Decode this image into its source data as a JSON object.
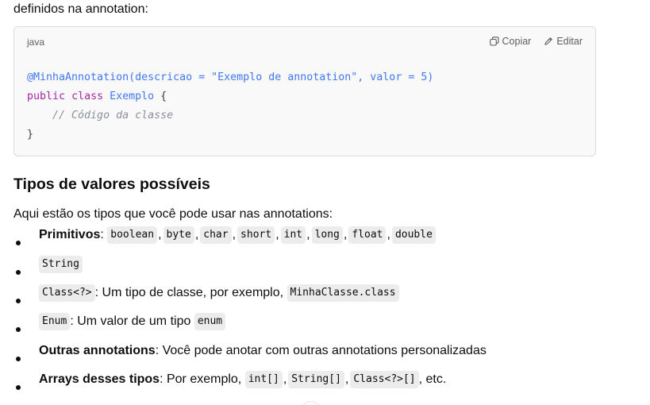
{
  "intro_text": "definidos na annotation:",
  "code_block": {
    "language": "java",
    "copy_label": "Copiar",
    "edit_label": "Editar",
    "lines": {
      "annotation": "@MinhaAnnotation(descricao = \"Exemplo de annotation\", valor = 5)",
      "kw_public": "public",
      "kw_class": "class",
      "class_name": "Exemplo",
      "brace_open": "{",
      "comment": "    // Código da classe",
      "brace_close": "}"
    }
  },
  "section": {
    "heading": "Tipos de valores possíveis",
    "intro": "Aqui estão os tipos que você pode usar nas annotations:"
  },
  "bullets": {
    "primitives": {
      "label": "Primitivos",
      "colon": ":",
      "types": [
        "boolean",
        "byte",
        "char",
        "short",
        "int",
        "long",
        "float",
        "double"
      ]
    },
    "string": {
      "code": "String"
    },
    "class": {
      "code": "Class<?>",
      "text": ": Um tipo de classe, por exemplo,",
      "example": "MinhaClasse.class"
    },
    "enum": {
      "code": "Enum",
      "text": ": Um valor de um tipo",
      "example": "enum"
    },
    "other_annotations": {
      "label": "Outras annotations",
      "text": ": Você pode anotar com outras annotations personalizadas"
    },
    "arrays": {
      "label": "Arrays desses tipos",
      "text": ": Por exemplo,",
      "examples": [
        "int[]",
        "String[]",
        "Class<?>[]"
      ],
      "suffix": ", etc."
    }
  }
}
